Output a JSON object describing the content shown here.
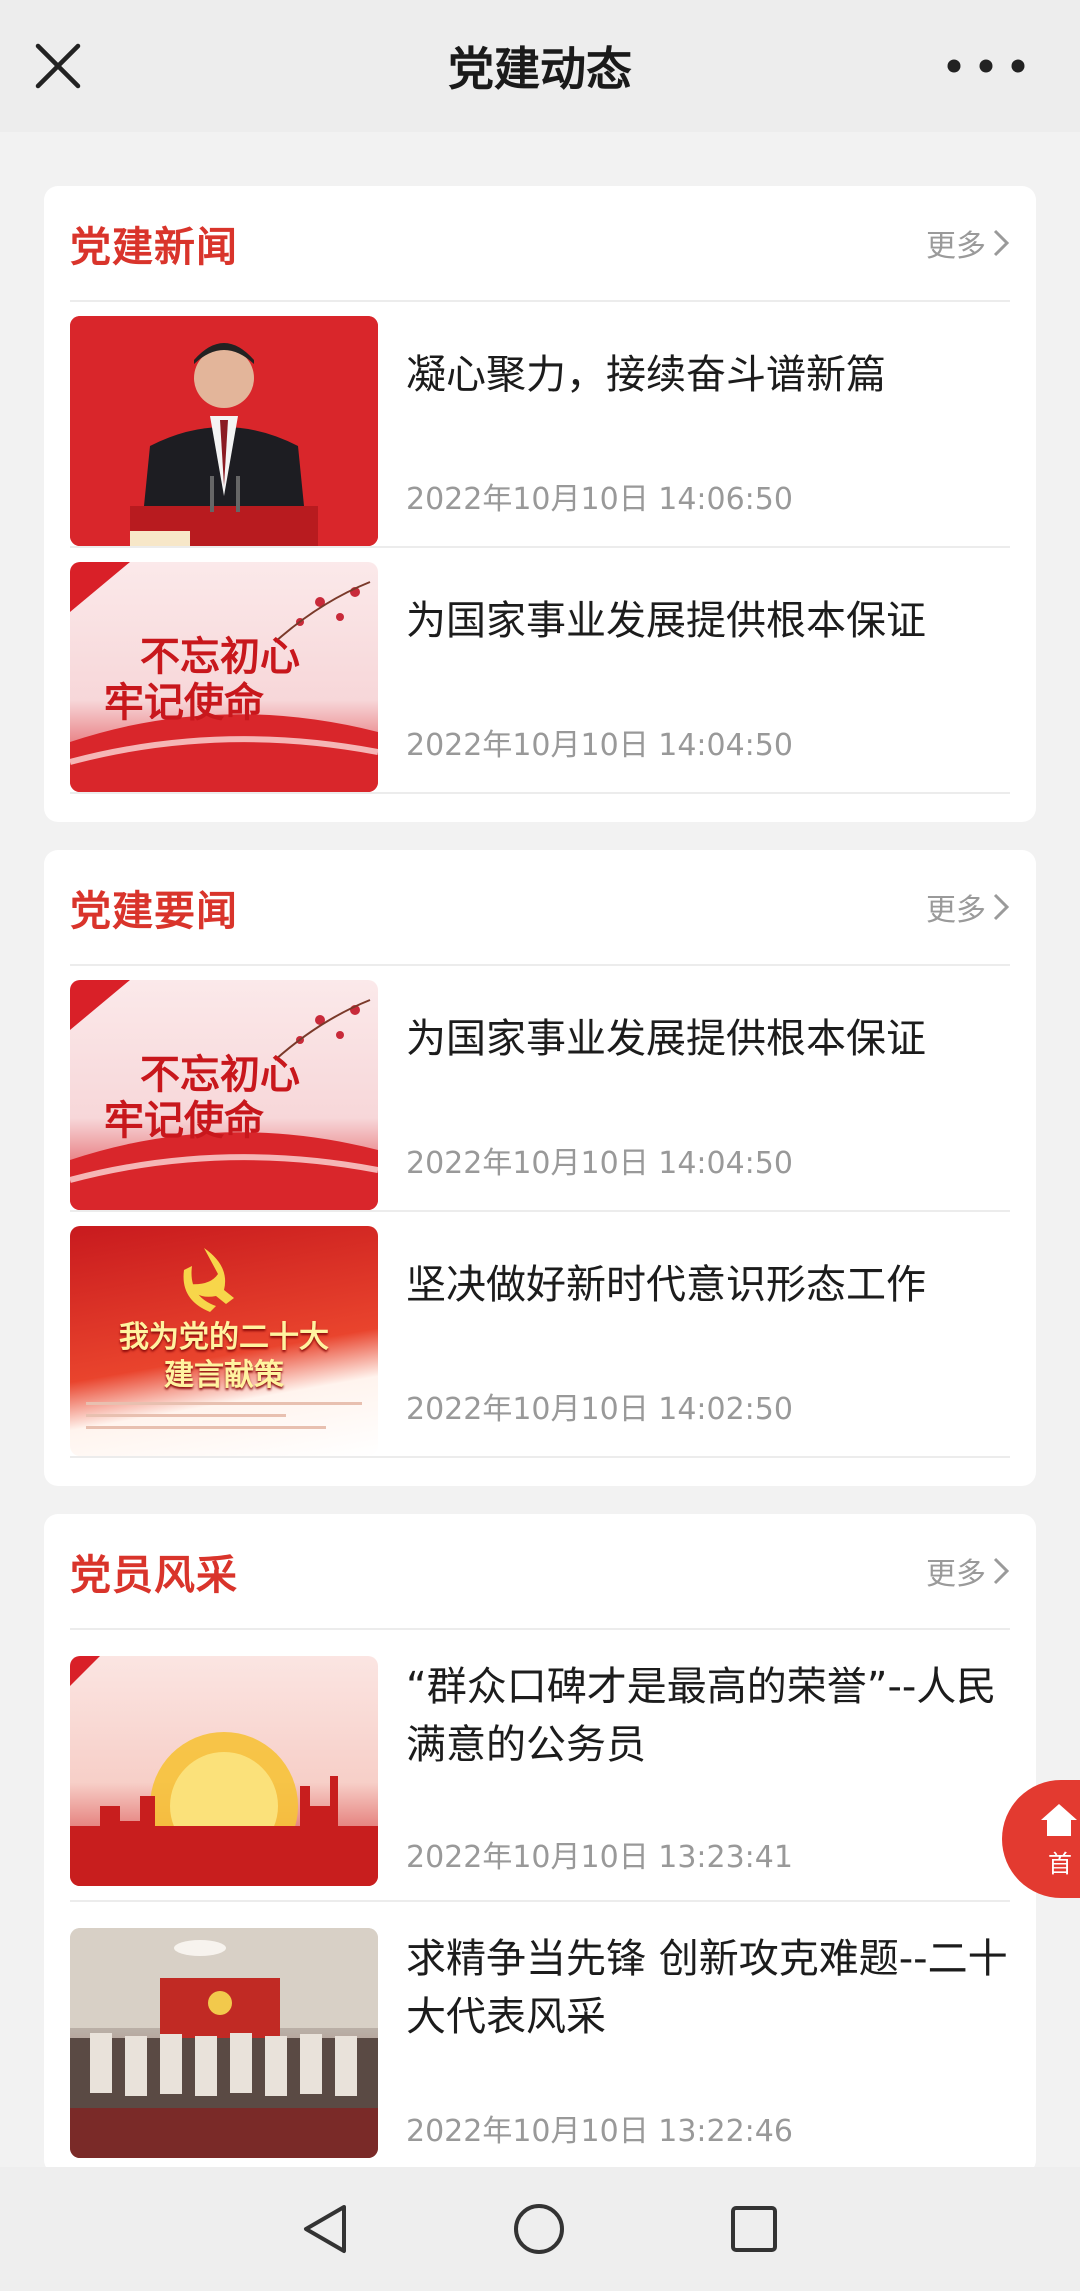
{
  "header": {
    "title": "党建动态",
    "close_icon": "close-icon",
    "more_icon": "more-dots-icon"
  },
  "sections": [
    {
      "title": "党建新闻",
      "more_label": "更多",
      "items": [
        {
          "title": "凝心聚力，接续奋斗谱新篇",
          "time": "2022年10月10日 14:06:50",
          "thumb": "red-portrait"
        },
        {
          "title": "为国家事业发展提供根本保证",
          "time": "2022年10月10日 14:04:50",
          "thumb": "banner",
          "thumb_text": [
            "不忘初心",
            "牢记使命"
          ]
        }
      ]
    },
    {
      "title": "党建要闻",
      "more_label": "更多",
      "items": [
        {
          "title": "为国家事业发展提供根本保证",
          "time": "2022年10月10日 14:04:50",
          "thumb": "banner",
          "thumb_text": [
            "不忘初心",
            "牢记使命"
          ]
        },
        {
          "title": "坚决做好新时代意识形态工作",
          "time": "2022年10月10日 14:02:50",
          "thumb": "party",
          "thumb_text": [
            "我为党的二十大",
            "建言献策"
          ]
        }
      ]
    },
    {
      "title": "党员风采",
      "more_label": "更多",
      "items": [
        {
          "title": "“群众口碑才是最高的荣誉”--人民满意的公务员",
          "time": "2022年10月10日 13:23:41",
          "thumb": "sun"
        },
        {
          "title": "求精争当先锋 创新攻克难题--二十大代表风采",
          "time": "2022年10月10日 13:22:46",
          "thumb": "meeting"
        }
      ]
    }
  ],
  "float_button": {
    "label": "首",
    "icon": "home-icon"
  },
  "navbar": {
    "back_icon": "back-triangle-icon",
    "home_icon": "home-circle-icon",
    "recent_icon": "recent-square-icon"
  },
  "colors": {
    "accent": "#d9342b",
    "background": "#f2f2f2",
    "card": "#ffffff",
    "muted": "#999999"
  }
}
